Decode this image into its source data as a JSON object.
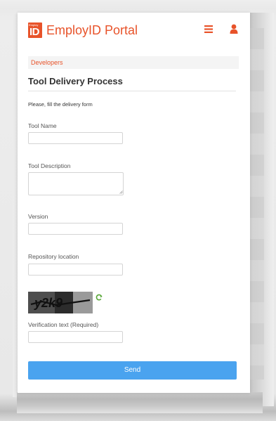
{
  "header": {
    "logo_small_text": "Employ",
    "logo_big_text": "ID",
    "brand_title": "EmployID Portal",
    "menu_icon": "hamburger-menu-icon",
    "user_icon": "user-icon"
  },
  "breadcrumb": {
    "label": "Developers"
  },
  "page": {
    "title": "Tool Delivery Process",
    "intro": "Please, fill the delivery form"
  },
  "form": {
    "tool_name": {
      "label": "Tool Name",
      "value": "",
      "placeholder": ""
    },
    "tool_description": {
      "label": "Tool Description",
      "value": "",
      "placeholder": ""
    },
    "version": {
      "label": "Version",
      "value": "",
      "placeholder": ""
    },
    "repository_location": {
      "label": "Repository location",
      "value": "",
      "placeholder": ""
    },
    "captcha": {
      "text": "y2k9",
      "refresh_icon": "refresh-icon"
    },
    "verification_text": {
      "label": "Verification text (Required)",
      "value": "",
      "placeholder": ""
    },
    "send_label": "Send"
  },
  "colors": {
    "brand": "#e8532a",
    "primary_button": "#4aa3ef",
    "breadcrumb_bg": "#f4f4f4"
  }
}
